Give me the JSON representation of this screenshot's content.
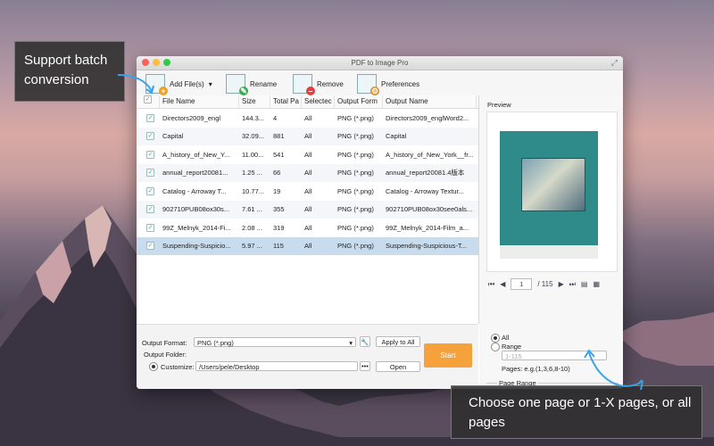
{
  "window": {
    "title": "PDF to Image Pro"
  },
  "toolbar": {
    "add_label": "Add File(s)",
    "rename_label": "Rename",
    "remove_label": "Remove",
    "preferences_label": "Preferences"
  },
  "table": {
    "headers": [
      "File Name",
      "Size",
      "Total Pa",
      "Selectec",
      "Output Form",
      "Output Name"
    ],
    "rows": [
      {
        "name": "Directors2009_engl",
        "size": "144.3...",
        "pages": "4",
        "sel": "All",
        "format": "PNG (*.png)",
        "out": "Directors2009_englWord2..."
      },
      {
        "name": "Capital",
        "size": "32.09...",
        "pages": "881",
        "sel": "All",
        "format": "PNG (*.png)",
        "out": "Capital"
      },
      {
        "name": "A_history_of_New_Y...",
        "size": "11.00...",
        "pages": "541",
        "sel": "All",
        "format": "PNG (*.png)",
        "out": "A_history_of_New_York__fr..."
      },
      {
        "name": "annual_report20081...",
        "size": "1.25 ...",
        "pages": "66",
        "sel": "All",
        "format": "PNG (*.png)",
        "out": "annual_report20081.4版本"
      },
      {
        "name": "Catalog - Arroway T...",
        "size": "10.77...",
        "pages": "19",
        "sel": "All",
        "format": "PNG (*.png)",
        "out": "Catalog - Arroway Textur..."
      },
      {
        "name": "902710PUB08ox30s...",
        "size": "7.61 ...",
        "pages": "355",
        "sel": "All",
        "format": "PNG (*.png)",
        "out": "902710PUB08ox30see0als..."
      },
      {
        "name": "99Z_Melnyk_2014-Fi...",
        "size": "2.08 ...",
        "pages": "319",
        "sel": "All",
        "format": "PNG (*.png)",
        "out": "99Z_Melnyk_2014-Film_a..."
      },
      {
        "name": "Suspending-Suspicio...",
        "size": "5.97 ...",
        "pages": "115",
        "sel": "All",
        "format": "PNG (*.png)",
        "out": "Suspending-Suspicious-T..."
      }
    ]
  },
  "bottom": {
    "output_format_label": "Output Format:",
    "output_format_value": "PNG (*.png)",
    "apply_all_label": "Apply to All",
    "output_folder_label": "Output Folder:",
    "customize_label": "Customize:",
    "path_value": "/Users/pele/Desktop",
    "dots_label": "•••",
    "open_label": "Open",
    "start_label": "Start"
  },
  "preview": {
    "title": "Preview",
    "current_page": "1",
    "total_pages": "/ 115"
  },
  "page_range": {
    "title": "Page Range",
    "all_label": "All",
    "range_label": "Range",
    "range_placeholder": "1-115",
    "hint": "Pages: e.g.(1,3,6,8-10)"
  },
  "callouts": {
    "batch": "Support batch conversion",
    "pages": "Choose one page or 1-X pages, or all pages"
  },
  "colors": {
    "accent_orange": "#f5a13c",
    "selected_row": "#c8dcee"
  }
}
